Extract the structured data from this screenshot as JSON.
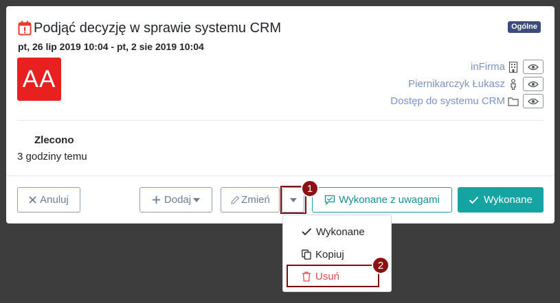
{
  "task": {
    "title": "Podjąć decyzję w sprawie systemu CRM",
    "category_badge": "Ogólne",
    "date_range": "pt, 26 lip 2019 10:04 - pt, 2 sie 2019 10:04",
    "avatar_initials": "AA"
  },
  "links": [
    {
      "label": "inFirma",
      "icon": "building-icon"
    },
    {
      "label": "Piernikarczyk Łukasz",
      "icon": "person-icon"
    },
    {
      "label": "Dostęp do systemu CRM",
      "icon": "folder-icon"
    }
  ],
  "status": {
    "label": "Zlecono",
    "time_ago": "3 godziny temu"
  },
  "footer": {
    "cancel_label": "Anuluj",
    "add_label": "Dodaj",
    "edit_label": "Zmień",
    "done_with_notes_label": "Wykonane z uwagami",
    "done_label": "Wykonane"
  },
  "dropdown_menu": {
    "items": [
      {
        "label": "Wykonane",
        "icon": "check-icon"
      },
      {
        "label": "Kopiuj",
        "icon": "copy-icon"
      },
      {
        "label": "Usuń",
        "icon": "trash-icon"
      }
    ]
  },
  "annotations": {
    "marker_1": "1",
    "marker_2": "2"
  },
  "colors": {
    "accent_teal": "#16a4a2",
    "badge_navy": "#3c4b7c",
    "avatar_red": "#e8201f",
    "danger_red": "#e2484b",
    "annotation_red": "#8b1214",
    "link_blue": "#7d93c2"
  }
}
